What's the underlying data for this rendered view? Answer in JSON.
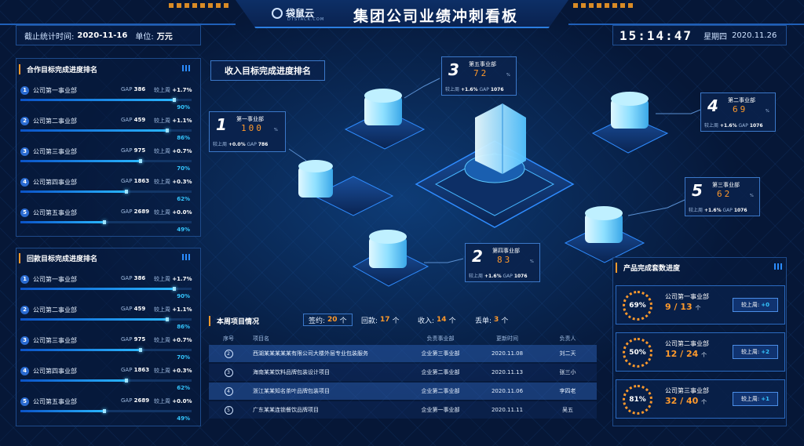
{
  "header": {
    "logo_text": "袋鼠云",
    "logo_sub": "DTSTACK.COM",
    "title": "集团公司业绩冲刺看板"
  },
  "info": {
    "deadline_label": "截止统计时间:",
    "deadline_value": "2020-11-16",
    "unit_label": "单位:",
    "unit_value": "万元",
    "clock": "15:14:47",
    "weekday": "星期四",
    "date": "2020.11.26"
  },
  "cooperation": {
    "title": "合作目标完成进度排名",
    "items": [
      {
        "no": "1",
        "name": "公司第一事业部",
        "gap_label": "GAP",
        "gap": "386",
        "cmp_label": "较上周",
        "cmp": "+1.7%",
        "pct": "90%",
        "fill": 0.9
      },
      {
        "no": "2",
        "name": "公司第二事业部",
        "gap_label": "GAP",
        "gap": "459",
        "cmp_label": "较上周",
        "cmp": "+1.1%",
        "pct": "86%",
        "fill": 0.86
      },
      {
        "no": "3",
        "name": "公司第三事业部",
        "gap_label": "GAP",
        "gap": "975",
        "cmp_label": "较上周",
        "cmp": "+0.7%",
        "pct": "70%",
        "fill": 0.7
      },
      {
        "no": "4",
        "name": "公司第四事业部",
        "gap_label": "GAP",
        "gap": "1863",
        "cmp_label": "较上周",
        "cmp": "+0.3%",
        "pct": "62%",
        "fill": 0.62
      },
      {
        "no": "5",
        "name": "公司第五事业部",
        "gap_label": "GAP",
        "gap": "2689",
        "cmp_label": "较上周",
        "cmp": "+0.0%",
        "pct": "49%",
        "fill": 0.49
      }
    ]
  },
  "payback": {
    "title": "回款目标完成进度排名",
    "items": [
      {
        "no": "1",
        "name": "公司第一事业部",
        "gap_label": "GAP",
        "gap": "386",
        "cmp_label": "较上周",
        "cmp": "+1.7%",
        "pct": "90%",
        "fill": 0.9
      },
      {
        "no": "2",
        "name": "公司第二事业部",
        "gap_label": "GAP",
        "gap": "459",
        "cmp_label": "较上周",
        "cmp": "+1.1%",
        "pct": "86%",
        "fill": 0.86
      },
      {
        "no": "3",
        "name": "公司第三事业部",
        "gap_label": "GAP",
        "gap": "975",
        "cmp_label": "较上周",
        "cmp": "+0.7%",
        "pct": "70%",
        "fill": 0.7
      },
      {
        "no": "4",
        "name": "公司第四事业部",
        "gap_label": "GAP",
        "gap": "1863",
        "cmp_label": "较上周",
        "cmp": "+0.3%",
        "pct": "62%",
        "fill": 0.62
      },
      {
        "no": "5",
        "name": "公司第五事业部",
        "gap_label": "GAP",
        "gap": "2689",
        "cmp_label": "较上周",
        "cmp": "+0.0%",
        "pct": "49%",
        "fill": 0.49
      }
    ]
  },
  "income_rank": {
    "title": "收入目标完成进度排名",
    "tags": [
      {
        "no": "1",
        "name": "第一事业部",
        "value": "100",
        "unit": "%",
        "cmp_label": "较上周",
        "cmp": "+0.0%",
        "gap_label": "GAP",
        "gap": "786"
      },
      {
        "no": "2",
        "name": "第四事业部",
        "value": "83",
        "unit": "%",
        "cmp_label": "较上周",
        "cmp": "+1.6%",
        "gap_label": "GAP",
        "gap": "1076"
      },
      {
        "no": "3",
        "name": "第五事业部",
        "value": "72",
        "unit": "%",
        "cmp_label": "较上周",
        "cmp": "+1.6%",
        "gap_label": "GAP",
        "gap": "1076"
      },
      {
        "no": "4",
        "name": "第二事业部",
        "value": "69",
        "unit": "%",
        "cmp_label": "较上周",
        "cmp": "+1.6%",
        "gap_label": "GAP",
        "gap": "1076"
      },
      {
        "no": "5",
        "name": "第三事业部",
        "value": "62",
        "unit": "%",
        "cmp_label": "较上周",
        "cmp": "+1.6%",
        "gap_label": "GAP",
        "gap": "1076"
      }
    ]
  },
  "week": {
    "title": "本周项目情况",
    "signed_label": "签约:",
    "signed": "20",
    "signed_unit": "个",
    "paid_label": "回款:",
    "paid": "17",
    "paid_unit": "个",
    "income_label": "收入:",
    "income": "14",
    "income_unit": "个",
    "lost_label": "丢单:",
    "lost": "3",
    "lost_unit": "个"
  },
  "table": {
    "headers": [
      "序号",
      "项目名",
      "负责事业部",
      "更新时间",
      "负责人"
    ],
    "rows": [
      {
        "no": "2",
        "name": "西湖某某某某某有限公司大楼外层专业包装服务",
        "dept": "企业第三事业部",
        "time": "2020.11.08",
        "owner": "刘二天"
      },
      {
        "no": "3",
        "name": "海南某某饮料品牌包装设计项目",
        "dept": "企业第二事业部",
        "time": "2020.11.13",
        "owner": "张三小"
      },
      {
        "no": "4",
        "name": "浙江某某知名茶叶品牌包装项目",
        "dept": "企业第二事业部",
        "time": "2020.11.06",
        "owner": "李四老"
      },
      {
        "no": "5",
        "name": "广东某某连锁餐饮品牌项目",
        "dept": "企业第一事业部",
        "time": "2020.11.11",
        "owner": "吴五"
      }
    ]
  },
  "products": {
    "title": "产品完成套数进度",
    "items": [
      {
        "pct": "69%",
        "name": "公司第一事业部",
        "done": "9",
        "total": "13",
        "unit": "个",
        "cmp_label": "较上周:",
        "cmp": "+0"
      },
      {
        "pct": "50%",
        "name": "公司第二事业部",
        "done": "12",
        "total": "24",
        "unit": "个",
        "cmp_label": "较上周:",
        "cmp": "+2"
      },
      {
        "pct": "81%",
        "name": "公司第三事业部",
        "done": "32",
        "total": "40",
        "unit": "个",
        "cmp_label": "较上周:",
        "cmp": "+1"
      }
    ]
  },
  "colors": {
    "background": "#061737",
    "accent": "#34c6ff",
    "highlight": "#ff9a2c"
  }
}
